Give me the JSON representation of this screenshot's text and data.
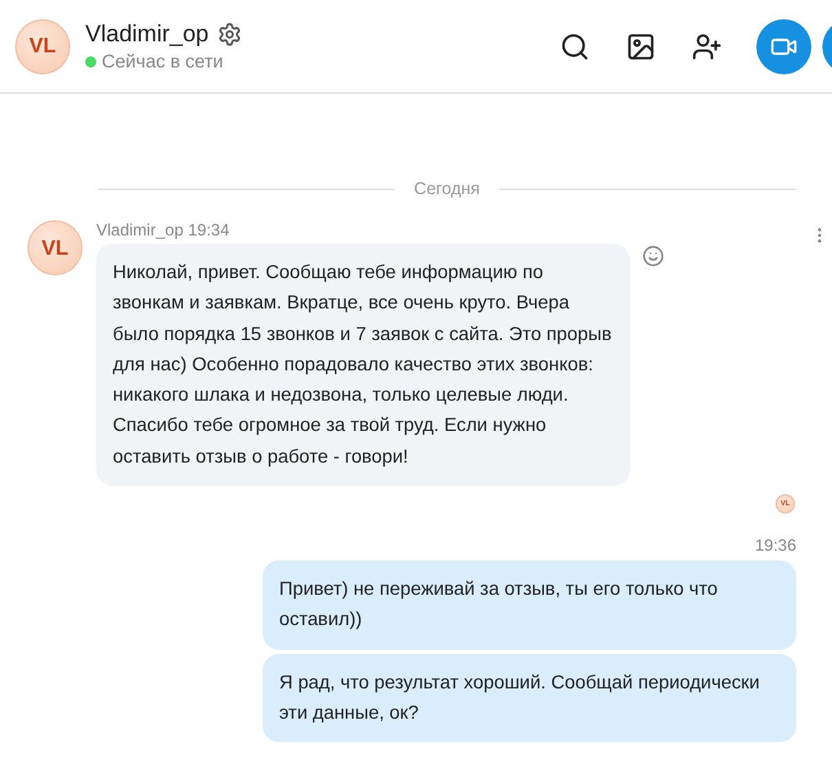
{
  "header": {
    "avatar": "VL",
    "name": "Vladimir_op",
    "status": "Сейчас в сети",
    "online": true
  },
  "date_divider": "Сегодня",
  "incoming": {
    "avatar": "VL",
    "sender": "Vladimir_op",
    "time": "19:34",
    "text": "Николай, привет. Сообщаю тебе информацию по звонкам и заявкам. Вкратце, все очень круто. Вчера было порядка 15 звонков и 7 заявок с сайта. Это прорыв для нас) Особенно порадовало качество этих звонков: никакого шлака и недозвона, только целевые люди. Спасибо тебе огромное за твой труд. Если нужно оставить отзыв о работе - говори!"
  },
  "read_receipt": "VL",
  "outgoing": {
    "time": "19:36",
    "messages": [
      "Привет) не переживай за отзыв, ты его только что оставил))",
      "Я рад, что результат хороший. Сообщай периодически эти данные, ок?"
    ]
  }
}
